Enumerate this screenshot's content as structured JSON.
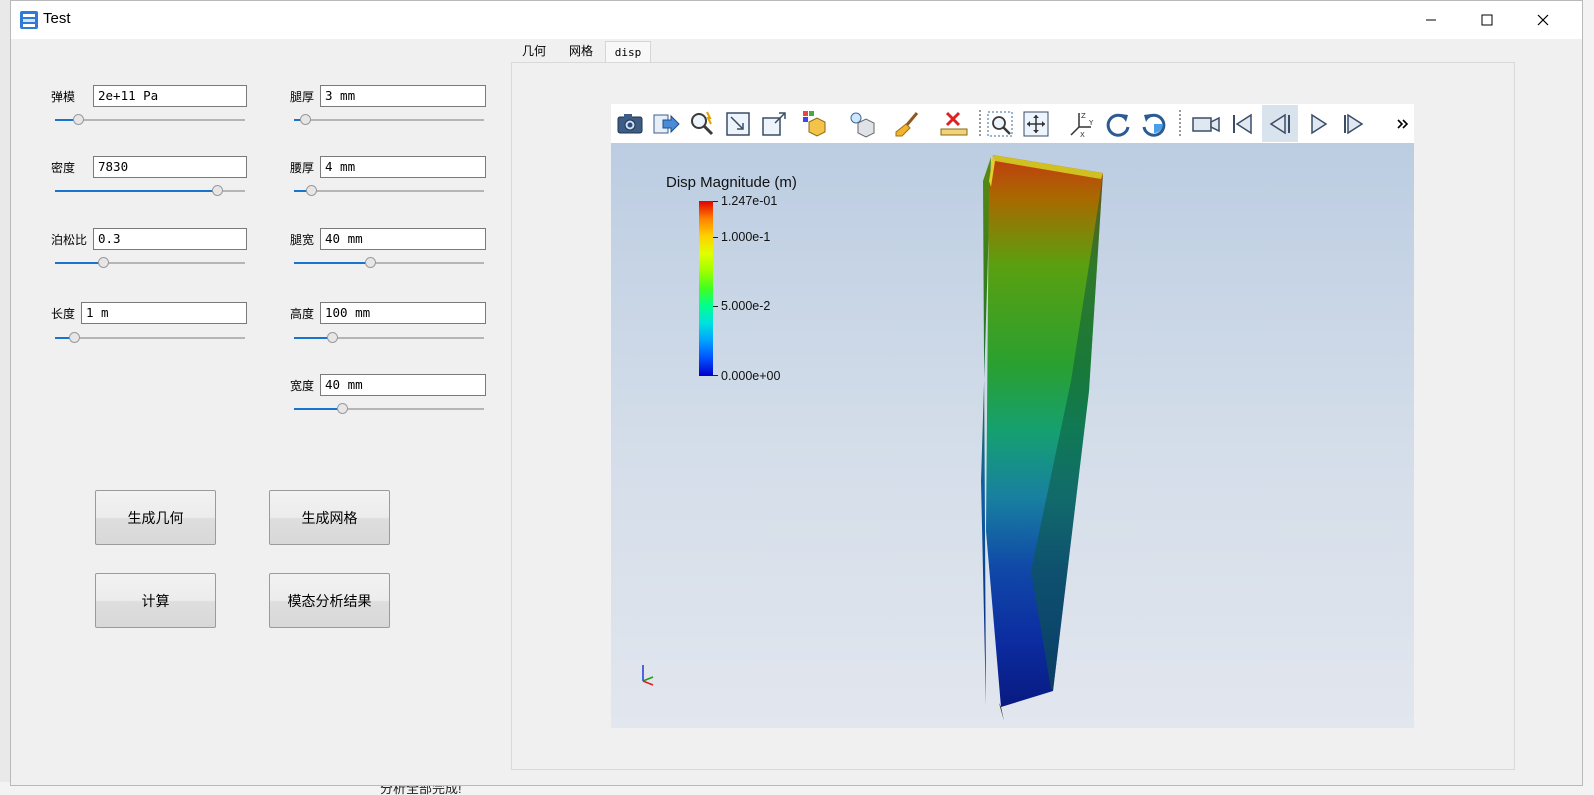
{
  "window": {
    "title": "Test"
  },
  "desktop": {
    "bottom_text": "分析全部完成!"
  },
  "params_left": [
    {
      "label": "弹模",
      "value": "2e+11 Pa",
      "slider": 0.12
    },
    {
      "label": "密度",
      "value": "7830",
      "slider": 0.85
    },
    {
      "label": "泊松比",
      "value": "0.3",
      "slider": 0.25
    },
    {
      "label": "长度",
      "value": "1 m",
      "slider": 0.1
    }
  ],
  "params_right": [
    {
      "label": "腿厚",
      "value": "3 mm",
      "slider": 0.06
    },
    {
      "label": "腰厚",
      "value": "4 mm",
      "slider": 0.09
    },
    {
      "label": "腿宽",
      "value": "40 mm",
      "slider": 0.4
    },
    {
      "label": "高度",
      "value": "100 mm",
      "slider": 0.2
    },
    {
      "label": "宽度",
      "value": "40 mm",
      "slider": 0.25
    }
  ],
  "buttons": {
    "gen_geometry": "生成几何",
    "gen_mesh": "生成网格",
    "compute": "计算",
    "modal_results": "模态分析结果"
  },
  "tabs": [
    "几何",
    "网格",
    "disp"
  ],
  "active_tab": "disp",
  "legend": {
    "title": "Disp Magnitude (m)",
    "max_label": "1.247e-01",
    "mid_high_label": "1.000e-1",
    "mid_label": "5.000e-2",
    "min_label": "0.000e+00"
  },
  "toolbar_icons": [
    "camera-icon",
    "export-icon",
    "interactive-select-icon",
    "reset-camera-icon",
    "zoom-to-box-icon",
    "color-map-icon",
    "light-icon",
    "brush-icon",
    "ruler-icon",
    "zoom-to-data-icon",
    "pan-icon",
    "axes-orientation-icon",
    "rotate-cw-icon",
    "rotate-ccw-icon",
    "video-camera-icon",
    "first-frame-icon",
    "prev-frame-icon",
    "play-icon",
    "last-frame-icon",
    "more-icon"
  ],
  "colors": {
    "slider_fill": "#1874cd",
    "viewport_top": "#bccde2",
    "viewport_bottom": "#e2e6ee"
  }
}
